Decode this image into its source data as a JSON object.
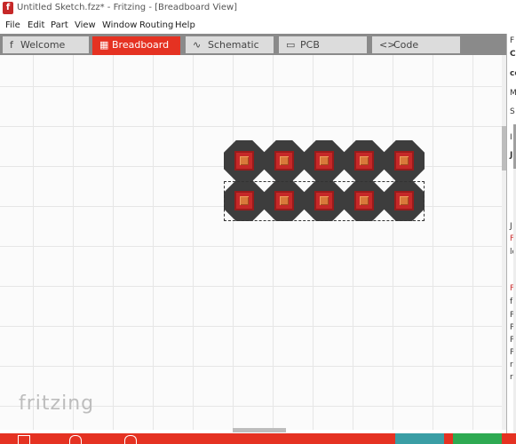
{
  "window": {
    "title": "Untitled Sketch.fzz* - Fritzing - [Breadboard View]",
    "app_icon": "f"
  },
  "menu": [
    "File",
    "Edit",
    "Part",
    "View",
    "Window",
    "Routing",
    "Help"
  ],
  "tabs": [
    {
      "label": "Welcome",
      "icon": "f"
    },
    {
      "label": "Breadboard",
      "icon": "▦"
    },
    {
      "label": "Schematic",
      "icon": "∿"
    },
    {
      "label": "PCB",
      "icon": "▭"
    },
    {
      "label": "Code",
      "icon": "<>"
    }
  ],
  "active_tab": "Breadboard",
  "canvas": {
    "watermark": "fritzing"
  },
  "part": {
    "rows": 2,
    "cols": 5
  },
  "right_panel": {
    "fragments": [
      "F",
      "C",
      "co",
      "M",
      "S",
      "I",
      "J",
      "J",
      "F",
      "lo",
      "F",
      "f",
      "P",
      "P",
      "P",
      "P",
      "r",
      "r"
    ]
  },
  "colors": {
    "accent": "#e53222",
    "teal": "#3a9ea5",
    "green": "#2eaa52"
  }
}
